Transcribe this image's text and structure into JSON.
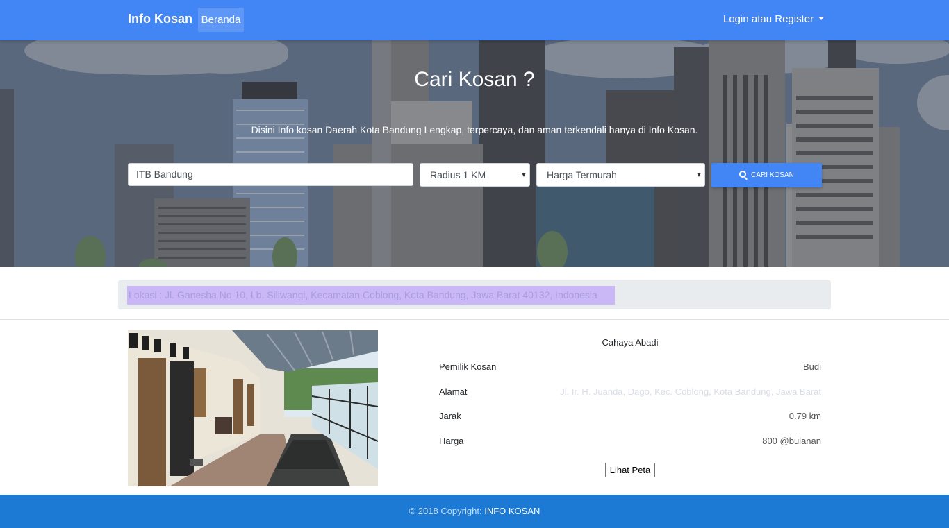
{
  "navbar": {
    "brand": "Info Kosan",
    "home_label": "Beranda",
    "login_label": "Login atau Register"
  },
  "hero": {
    "title": "Cari Kosan ?",
    "subtitle": "Disini Info kosan Daerah Kota Bandung Lengkap, terpercaya, dan aman terkendali hanya di Info Kosan."
  },
  "search": {
    "location_value": "ITB Bandung",
    "radius_selected": "Radius 1 KM",
    "sort_selected": "Harga Termurah",
    "button_label": "CARI KOSAN"
  },
  "location_bar": {
    "text": "Lokasi : Jl. Ganesha No.10, Lb. Siliwangi, Kecamatan Coblong, Kota Bandung, Jawa Barat 40132, Indonesia"
  },
  "listing": {
    "name": "Cahaya Abadi",
    "rows": [
      {
        "label": "Pemilik Kosan",
        "value": "Budi"
      },
      {
        "label": "Alamat",
        "value": "Jl. Ir. H. Juanda, Dago, Kec. Coblong, Kota Bandung, Jawa Barat"
      },
      {
        "label": "Jarak",
        "value": "0.79 km"
      },
      {
        "label": "Harga",
        "value": "800 @bulanan"
      }
    ],
    "map_button": "Lihat Peta"
  },
  "footer": {
    "copyright": "© 2018 Copyright:",
    "link": "INFO KOSAN"
  },
  "colors": {
    "primary": "#4285f4",
    "footer": "#1c7ad4",
    "hero_sky": "#6f84a5"
  }
}
